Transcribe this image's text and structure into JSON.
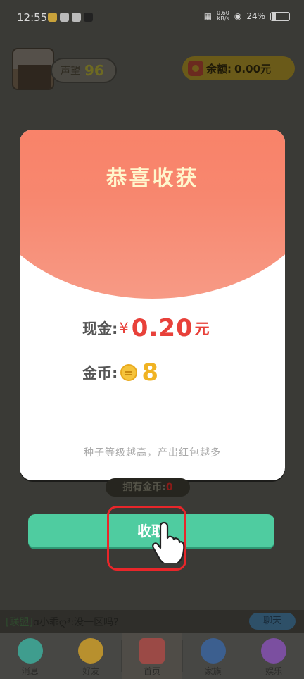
{
  "status_bar": {
    "time": "12:55",
    "net_speed_value": "0.60",
    "net_speed_unit": "KB/s",
    "battery": "24%"
  },
  "header": {
    "reputation_label": "声望",
    "reputation_value": "96",
    "balance_label": "余额:",
    "balance_value": "0.00元"
  },
  "modal": {
    "title": "恭喜收获",
    "cash_label": "现金:",
    "cash_currency": "¥",
    "cash_value": "0.20",
    "cash_unit": "元",
    "coin_label": "金币:",
    "coin_value": "8",
    "tip": "种子等级越高，产出红包越多"
  },
  "own_coins": {
    "label": "拥有金币:",
    "value": "0"
  },
  "collect_button": {
    "label": "收取"
  },
  "chat": {
    "channel": "[联盟]",
    "message": "ɑ小乖ღ³:没一区吗?",
    "button": "聊天"
  },
  "nav": {
    "items": [
      {
        "label": "消息",
        "icon": "message-icon",
        "color": "#3f9d8e"
      },
      {
        "label": "好友",
        "icon": "friend-icon",
        "color": "#b8902e"
      },
      {
        "label": "首页",
        "icon": "home-icon",
        "color": "#9b4a46"
      },
      {
        "label": "家族",
        "icon": "family-icon",
        "color": "#3c5f8f"
      },
      {
        "label": "娱乐",
        "icon": "planet-icon",
        "color": "#7b4fa0"
      }
    ]
  },
  "colors": {
    "accent_red": "#e8413a",
    "coin_gold": "#f0b323",
    "button_green": "#4fcca0",
    "highlight_red": "#e8262a"
  }
}
